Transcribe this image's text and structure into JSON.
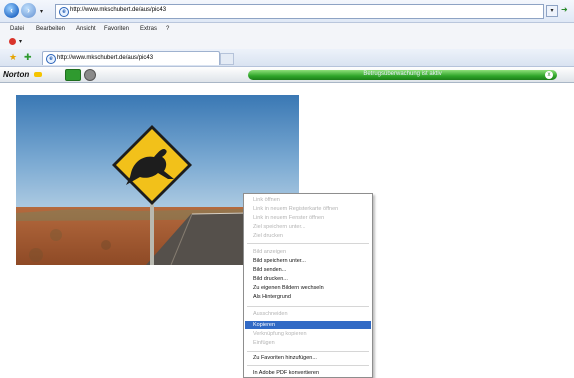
{
  "browser": {
    "address_url": "http://www.mkschubert.de/aus/pic43",
    "tab_title": "http://www.mkschubert.de/aus/pic43",
    "menu": [
      "Datei",
      "Bearbeiten",
      "Ansicht",
      "Favoriten",
      "Extras",
      "?"
    ]
  },
  "norton": {
    "logo": "Norton",
    "status": "Betrugsüberwachung ist aktiv",
    "close_label": "x"
  },
  "context_menu": {
    "items": [
      {
        "label": "Link öffnen",
        "state": "disabled"
      },
      {
        "label": "Link in neuem Registerkarte öffnen",
        "state": "disabled"
      },
      {
        "label": "Link in neuem Fenster öffnen",
        "state": "disabled"
      },
      {
        "label": "Ziel speichern unter...",
        "state": "disabled"
      },
      {
        "label": "Ziel drucken",
        "state": "disabled"
      },
      {
        "label": "Bild anzeigen",
        "state": "disabled"
      },
      {
        "label": "Bild speichern unter...",
        "state": "enabled"
      },
      {
        "label": "Bild senden...",
        "state": "enabled"
      },
      {
        "label": "Bild drucken...",
        "state": "enabled"
      },
      {
        "label": "Zu eigenen Bildern wechseln",
        "state": "enabled"
      },
      {
        "label": "Als Hintergrund",
        "state": "enabled"
      },
      {
        "label": "Ausschneiden",
        "state": "disabled"
      },
      {
        "label": "Kopieren",
        "state": "selected"
      },
      {
        "label": "Verknüpfung kopieren",
        "state": "disabled"
      },
      {
        "label": "Einfügen",
        "state": "disabled"
      },
      {
        "label": "Zu Favoriten hinzufügen...",
        "state": "enabled"
      },
      {
        "label": "In Adobe PDF konvertieren",
        "state": "enabled"
      }
    ]
  },
  "colors": {
    "selection": "#316ac5",
    "norton_green": "#2fa52a",
    "sign_yellow": "#f2c11a"
  }
}
